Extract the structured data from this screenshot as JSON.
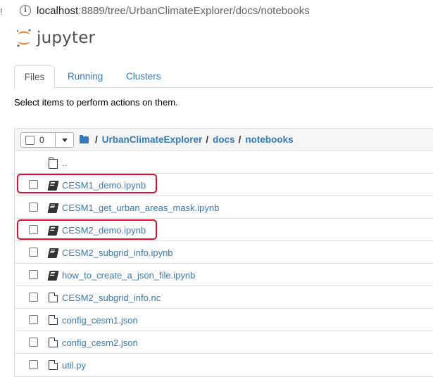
{
  "browser": {
    "left_mark": "!",
    "url_host": "localhost",
    "url_rest": ":8889/tree/UrbanClimateExplorer/docs/notebooks"
  },
  "app": {
    "logo_text": "jupyter"
  },
  "tabs": [
    {
      "label": "Files",
      "active": true
    },
    {
      "label": "Running",
      "active": false
    },
    {
      "label": "Clusters",
      "active": false
    }
  ],
  "instructions": "Select items to perform actions on them.",
  "toolbar": {
    "selected_count": "0",
    "breadcrumb": [
      "UrbanClimateExplorer",
      "docs",
      "notebooks"
    ],
    "separator": "/"
  },
  "files": [
    {
      "name": "..",
      "type": "parent"
    },
    {
      "name": "CESM1_demo.ipynb",
      "type": "notebook",
      "highlighted": true
    },
    {
      "name": "CESM1_get_urban_areas_mask.ipynb",
      "type": "notebook"
    },
    {
      "name": "CESM2_demo.ipynb",
      "type": "notebook",
      "highlighted": true
    },
    {
      "name": "CESM2_subgrid_info.ipynb",
      "type": "notebook"
    },
    {
      "name": "how_to_create_a_json_file.ipynb",
      "type": "notebook"
    },
    {
      "name": "CESM2_subgrid_info.nc",
      "type": "file"
    },
    {
      "name": "config_cesm1.json",
      "type": "file"
    },
    {
      "name": "config_cesm2.json",
      "type": "file"
    },
    {
      "name": "util.py",
      "type": "file"
    }
  ],
  "colors": {
    "link": "#337ab7",
    "highlight": "#e0102b",
    "logo_orange": "#f37726"
  }
}
